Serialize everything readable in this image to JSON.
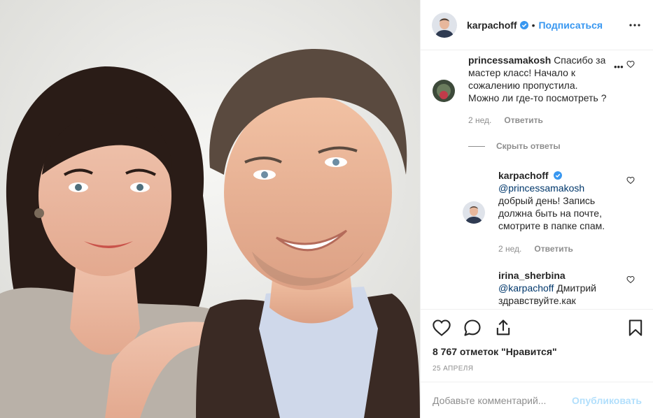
{
  "header": {
    "username": "karpachoff",
    "dot": "•",
    "follow_label": "Подписаться",
    "more_icon": "more-dots-icon"
  },
  "comments": [
    {
      "username": "princessamakosh",
      "text_lines": [
        "Спасибо за",
        "мастер класс! Начало к",
        "сожалению пропустила.",
        "Можно ли где-то посмотреть ?"
      ],
      "age": "2 нед.",
      "reply_label": "Ответить"
    },
    {
      "hide_replies_label": "Скрыть ответы"
    },
    {
      "username": "karpachoff",
      "mention": "@princessamakosh",
      "text_lines": [
        "добрый день! Запись",
        "должна быть на почте,",
        "смотрите в папке спам."
      ],
      "age": "2 нед.",
      "reply_label": "Ответить"
    },
    {
      "username": "irina_sherbina",
      "mention": "@karpachoff",
      "text_lines": [
        "Дмитрий",
        "здравствуйте.как"
      ]
    }
  ],
  "actions": {
    "icons": [
      "heart-icon",
      "comment-icon",
      "share-icon",
      "bookmark-icon"
    ],
    "likes": "8 767 отметок \"Нравится\"",
    "date": "25 АПРЕЛЯ"
  },
  "add_comment": {
    "placeholder": "Добавьте комментарий...",
    "publish_label": "Опубликовать"
  },
  "colors": {
    "link": "#3897f0",
    "publish_disabled": "#b2dffc",
    "muted": "#8e8e8e",
    "verified": "#3897f0"
  }
}
